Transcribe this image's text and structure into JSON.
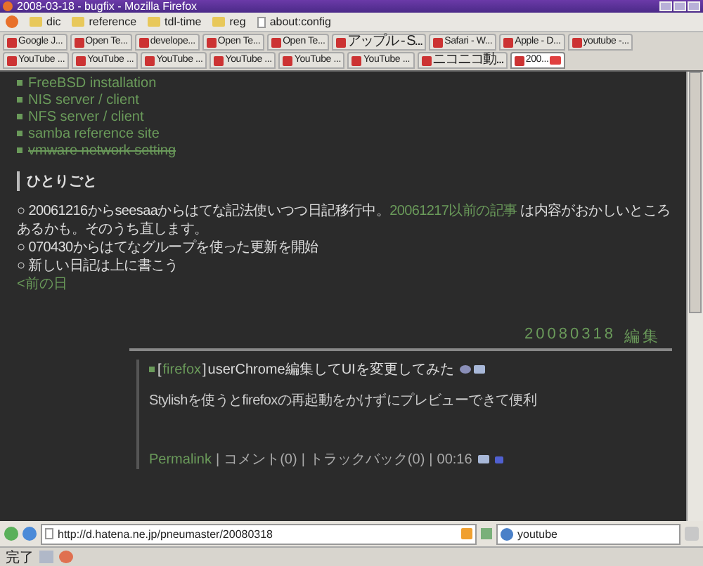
{
  "window": {
    "title": "2008-03-18 - bugfix - Mozilla Firefox"
  },
  "bookmarks": [
    {
      "label": "dic",
      "kind": "folder"
    },
    {
      "label": "reference",
      "kind": "folder"
    },
    {
      "label": "tdl-time",
      "kind": "folder"
    },
    {
      "label": "reg",
      "kind": "folder"
    },
    {
      "label": "about:config",
      "kind": "page"
    }
  ],
  "tab_rows": [
    [
      {
        "label": "Google J...",
        "selected": false
      },
      {
        "label": "Open Te...",
        "selected": false
      },
      {
        "label": "develope...",
        "selected": false
      },
      {
        "label": "Open Te...",
        "selected": false
      },
      {
        "label": "Open Te...",
        "selected": false
      },
      {
        "label": "アップル - S...",
        "selected": false
      },
      {
        "label": "Safari - W...",
        "selected": false
      },
      {
        "label": "Apple - D...",
        "selected": false
      },
      {
        "label": "youtube -...",
        "selected": false
      }
    ],
    [
      {
        "label": "YouTube ...",
        "selected": false
      },
      {
        "label": "YouTube ...",
        "selected": false
      },
      {
        "label": "YouTube ...",
        "selected": false
      },
      {
        "label": "YouTube ...",
        "selected": false
      },
      {
        "label": "YouTube ...",
        "selected": false
      },
      {
        "label": "YouTube ...",
        "selected": false
      },
      {
        "label": "ニコニコ動...",
        "selected": false
      },
      {
        "label": "200...",
        "selected": true
      }
    ]
  ],
  "page": {
    "link_list": [
      {
        "label": "FreeBSD installation",
        "struck": false
      },
      {
        "label": "NIS server / client",
        "struck": false
      },
      {
        "label": "NFS server / client",
        "struck": false
      },
      {
        "label": "samba reference site",
        "struck": false
      },
      {
        "label": "vmware network setting",
        "struck": true
      }
    ],
    "section_heading": "ひとりごと",
    "notes": [
      {
        "parts": [
          {
            "text": "○ 20061216からseesaaからはてな記法使いつつ日記移行中。",
            "link": false
          },
          {
            "text": "20061217以前の記事",
            "link": true
          },
          {
            "text": " は内容がおかしいところあるかも。そのうち直します。",
            "link": false
          }
        ]
      },
      {
        "parts": [
          {
            "text": "○ 070430からはてなグループを使った更新を開始",
            "link": false
          }
        ]
      },
      {
        "parts": [
          {
            "text": "○ 新しい日記は上に書こう",
            "link": false
          }
        ]
      }
    ],
    "prev_day": "<前の日",
    "date": "20080318",
    "edit": "編集",
    "entry": {
      "bracket_open": "[",
      "category": "firefox",
      "bracket_close": "]",
      "title": "userChrome編集してUIを変更してみた",
      "body": "Stylishを使うとfirefoxの再起動をかけずにプレビューできて便利",
      "footer": [
        {
          "text": "Permalink",
          "kind": "permalink"
        },
        {
          "text": "|",
          "kind": "separator"
        },
        {
          "text": "コメント(0)",
          "kind": "comments"
        },
        {
          "text": "|",
          "kind": "separator"
        },
        {
          "text": "トラックバック(0)",
          "kind": "trackbacks"
        },
        {
          "text": "|",
          "kind": "separator"
        },
        {
          "text": "00:16",
          "kind": "time"
        }
      ]
    }
  },
  "address_bar": {
    "url": "http://d.hatena.ne.jp/pneumaster/20080318"
  },
  "search_bar": {
    "value": "youtube"
  },
  "status_bar": {
    "text": "完了"
  }
}
